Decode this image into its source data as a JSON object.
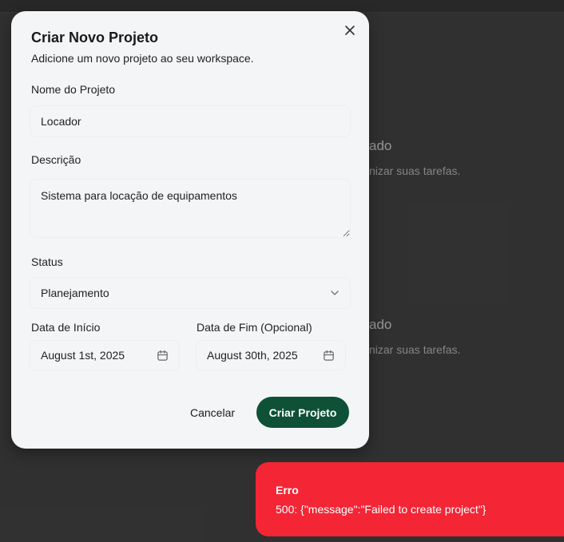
{
  "background": {
    "cards": [
      {
        "title": "ado",
        "subtitle": "nizar suas tarefas."
      },
      {
        "title": "ado",
        "subtitle": "nizar suas tarefas."
      }
    ]
  },
  "modal": {
    "title": "Criar Novo Projeto",
    "subtitle": "Adicione um novo projeto ao seu workspace.",
    "close_icon": "close-icon",
    "name": {
      "label": "Nome do Projeto",
      "value": "Locador"
    },
    "description": {
      "label": "Descrição",
      "value": "Sistema para locação de equipamentos"
    },
    "status": {
      "label": "Status",
      "value": "Planejamento",
      "icon": "chevron-down-icon"
    },
    "start_date": {
      "label": "Data de Início",
      "value": "August 1st, 2025",
      "icon": "calendar-icon"
    },
    "end_date": {
      "label": "Data de Fim (Opcional)",
      "value": "August 30th, 2025",
      "icon": "calendar-icon"
    },
    "cancel_label": "Cancelar",
    "submit_label": "Criar Projeto"
  },
  "toast": {
    "title": "Erro",
    "message": "500: {\"message\":\"Failed to create project\"}"
  },
  "colors": {
    "primary": "#0e5137",
    "error": "#f42535",
    "modal_bg": "#f3f5f7",
    "page_bg": "#3b3b3b"
  }
}
